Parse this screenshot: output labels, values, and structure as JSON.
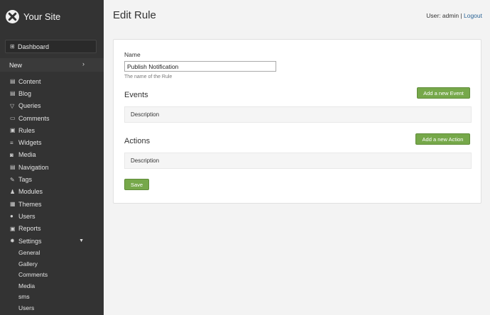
{
  "brand": {
    "title": "Your Site"
  },
  "sidebar": {
    "dashboard": "Dashboard",
    "new": "New",
    "items": [
      {
        "label": "Content",
        "icon": "document-icon"
      },
      {
        "label": "Blog",
        "icon": "document-icon"
      },
      {
        "label": "Queries",
        "icon": "filter-icon"
      },
      {
        "label": "Comments",
        "icon": "comment-icon"
      },
      {
        "label": "Rules",
        "icon": "rules-icon"
      },
      {
        "label": "Widgets",
        "icon": "widgets-icon"
      },
      {
        "label": "Media",
        "icon": "camera-icon"
      },
      {
        "label": "Navigation",
        "icon": "navigation-icon"
      },
      {
        "label": "Tags",
        "icon": "tag-icon"
      },
      {
        "label": "Modules",
        "icon": "modules-icon"
      },
      {
        "label": "Themes",
        "icon": "themes-icon"
      },
      {
        "label": "Users",
        "icon": "user-icon"
      },
      {
        "label": "Reports",
        "icon": "reports-icon"
      }
    ],
    "settings": "Settings",
    "settings_sub": [
      "General",
      "Gallery",
      "Comments",
      "Media",
      "sms",
      "Users"
    ]
  },
  "header": {
    "title": "Edit Rule",
    "user_text": "User: admin | ",
    "logout": "Logout"
  },
  "form": {
    "name_label": "Name",
    "name_value": "Publish Notification",
    "name_help": "The name of the Rule",
    "events_title": "Events",
    "add_event": "Add a new Event",
    "events_col": "Description",
    "actions_title": "Actions",
    "add_action": "Add a new Action",
    "actions_col": "Description",
    "save": "Save"
  },
  "colors": {
    "sidebar_bg": "#333333",
    "accent_green": "#76a84a",
    "link": "#2a6496"
  }
}
